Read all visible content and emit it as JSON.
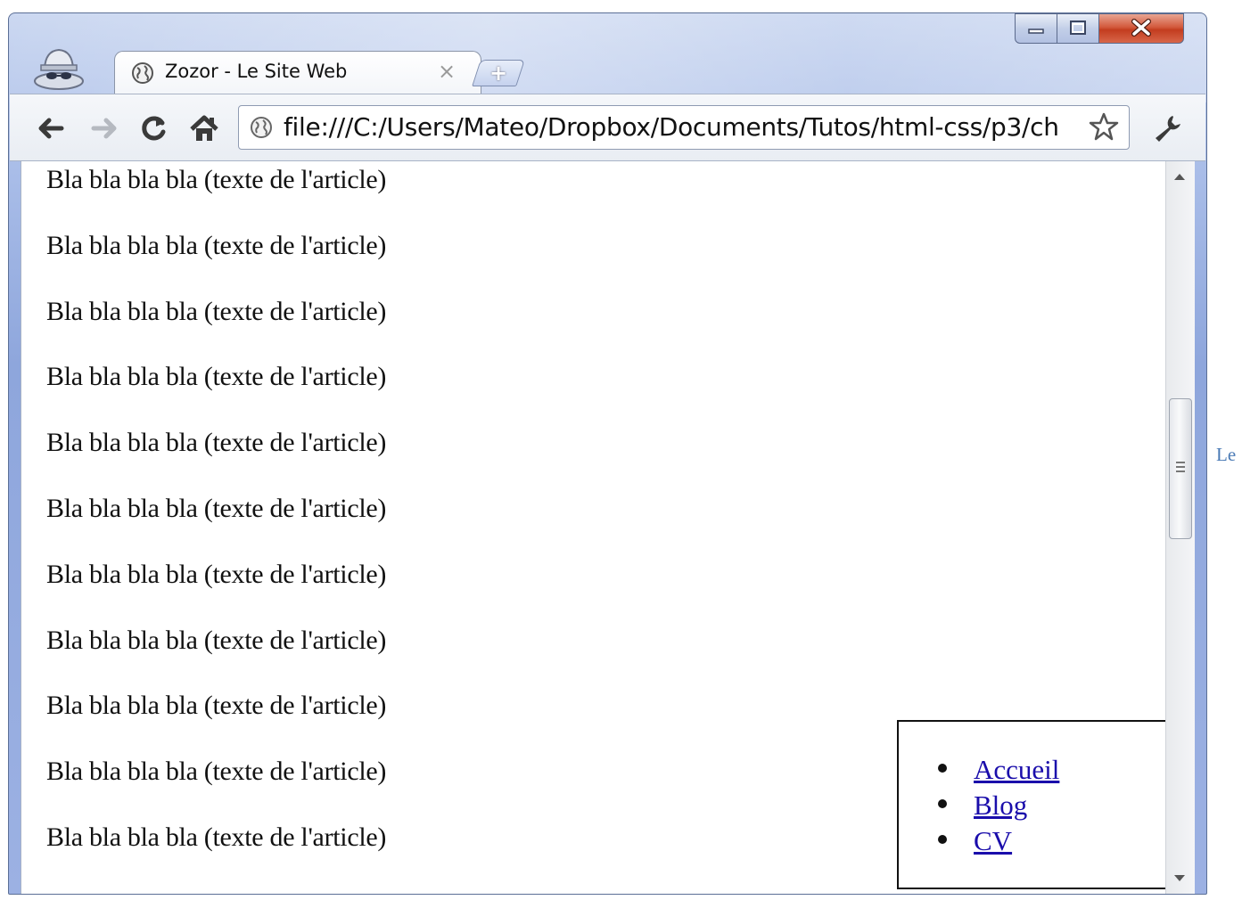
{
  "browser": {
    "tab_title": "Zozor - Le Site Web",
    "tab_close": "×",
    "new_tab_symbol": "+",
    "url": "file:///C:/Users/Mateo/Dropbox/Documents/Tutos/html-css/p3/ch",
    "icons": {
      "incognito": "incognito-icon",
      "back": "back-arrow-icon",
      "forward": "forward-arrow-icon",
      "reload": "reload-icon",
      "home": "home-icon",
      "page": "globe-icon",
      "bookmark": "star-icon",
      "settings": "wrench-icon"
    }
  },
  "page": {
    "paragraphs": [
      "Bla bla bla bla (texte de l'article)",
      "Bla bla bla bla (texte de l'article)",
      "Bla bla bla bla (texte de l'article)",
      "Bla bla bla bla (texte de l'article)",
      "Bla bla bla bla (texte de l'article)",
      "Bla bla bla bla (texte de l'article)",
      "Bla bla bla bla (texte de l'article)",
      "Bla bla bla bla (texte de l'article)",
      "Bla bla bla bla (texte de l'article)",
      "Bla bla bla bla (texte de l'article)",
      "Bla bla bla bla (texte de l'article)"
    ],
    "menu": [
      "Accueil",
      "Blog",
      "CV"
    ]
  },
  "outside_text": "Le",
  "colors": {
    "link": "#1a0dab",
    "frame": "#8ea6dc",
    "close_button": "#c33d1f"
  }
}
